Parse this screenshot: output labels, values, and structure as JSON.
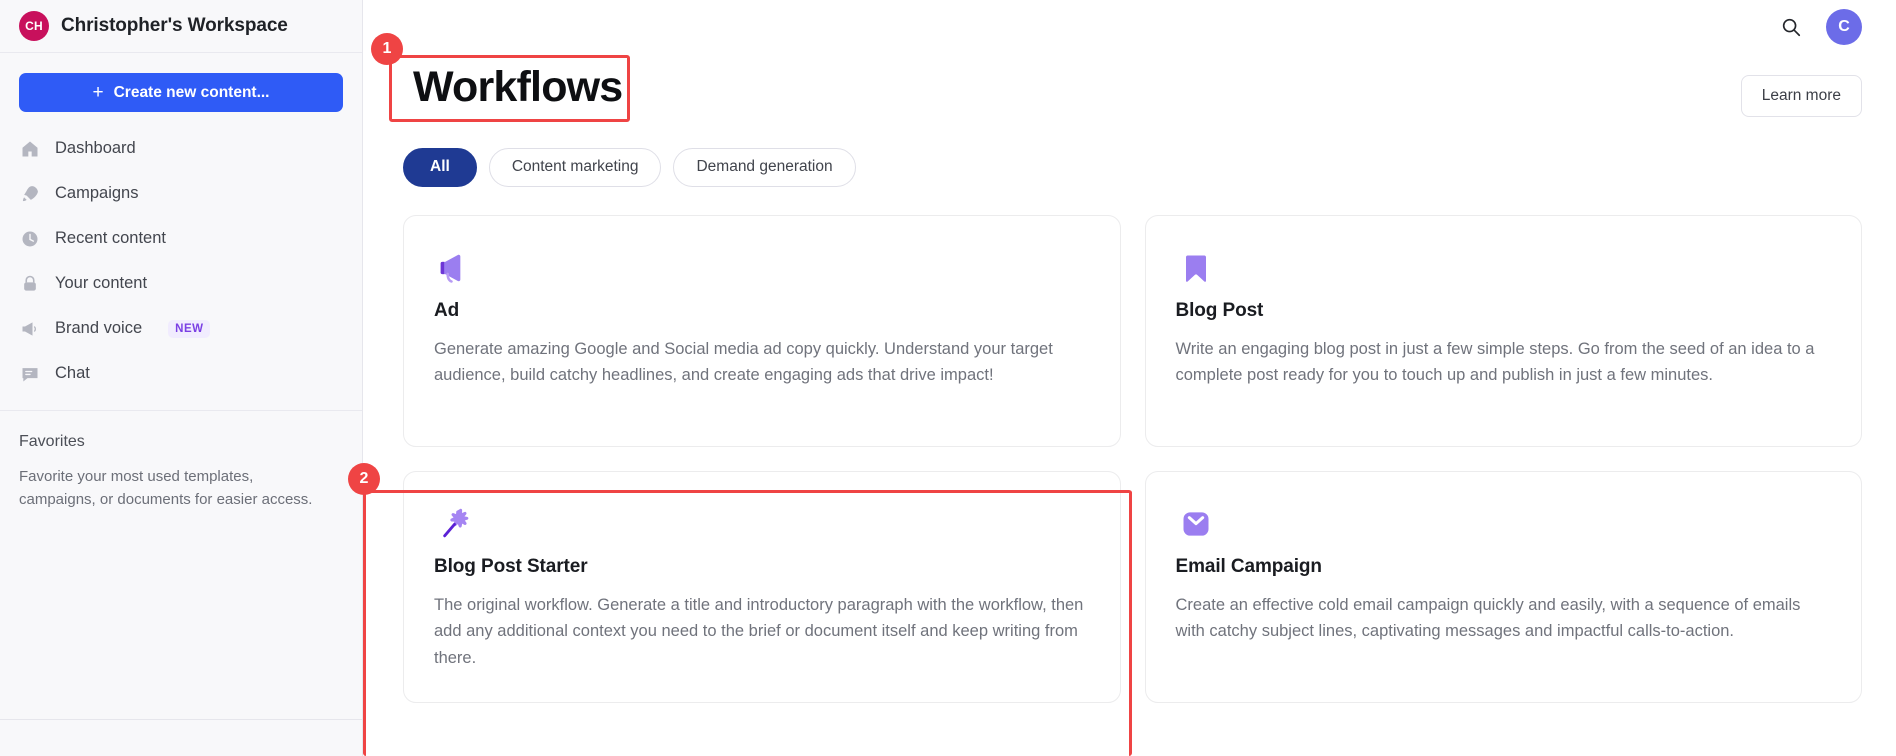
{
  "sidebar": {
    "workspace": {
      "initials": "CH",
      "name": "Christopher's Workspace"
    },
    "create_button": {
      "plus": "+",
      "label": "Create new content..."
    },
    "nav_items": [
      {
        "icon": "home-icon",
        "label": "Dashboard"
      },
      {
        "icon": "rocket-icon",
        "label": "Campaigns"
      },
      {
        "icon": "clock-icon",
        "label": "Recent content"
      },
      {
        "icon": "lock-icon",
        "label": "Your content"
      },
      {
        "icon": "megaphone-icon",
        "label": "Brand voice",
        "badge": "NEW"
      },
      {
        "icon": "chat-icon",
        "label": "Chat"
      }
    ],
    "favorites": {
      "title": "Favorites",
      "description": "Favorite your most used templates, campaigns, or documents for easier access."
    }
  },
  "topbar": {
    "search_icon": "search-icon",
    "user_initial": "C"
  },
  "header": {
    "title": "Workflows",
    "learn_more": "Learn more"
  },
  "filters": [
    {
      "label": "All",
      "active": true
    },
    {
      "label": "Content marketing",
      "active": false
    },
    {
      "label": "Demand generation",
      "active": false
    }
  ],
  "cards": [
    {
      "icon": "megaphone-icon",
      "title": "Ad",
      "description": "Generate amazing Google and Social media ad copy quickly. Understand your target audience, build catchy headlines, and create engaging ads that drive impact!"
    },
    {
      "icon": "bookmark-icon",
      "title": "Blog Post",
      "description": "Write an engaging blog post in just a few simple steps. Go from the seed of an idea to a complete post ready for you to touch up and publish in just a few minutes."
    },
    {
      "icon": "magic-wand-icon",
      "title": "Blog Post Starter",
      "description": "The original workflow. Generate a title and introductory paragraph with the workflow, then add any additional context you need to the brief or document itself and keep writing from there."
    },
    {
      "icon": "envelope-icon",
      "title": "Email Campaign",
      "description": "Create an effective cold email campaign quickly and easily, with a sequence of emails with catchy subject lines, captivating messages and impactful calls-to-action."
    }
  ],
  "annotations": [
    {
      "number": "1",
      "target": "page-title"
    },
    {
      "number": "2",
      "target": "blog-post-starter-card"
    }
  ],
  "colors": {
    "accent_blue": "#2f5bf6",
    "chip_active": "#1f3a93",
    "workspace_avatar": "#c8105c",
    "user_avatar": "#6c6ce8",
    "badge_new_text": "#7b3fe4",
    "badge_new_bg": "#f1ecfe",
    "annotation_red": "#ef4444",
    "card_icon_purple": "#9b7ef0"
  }
}
